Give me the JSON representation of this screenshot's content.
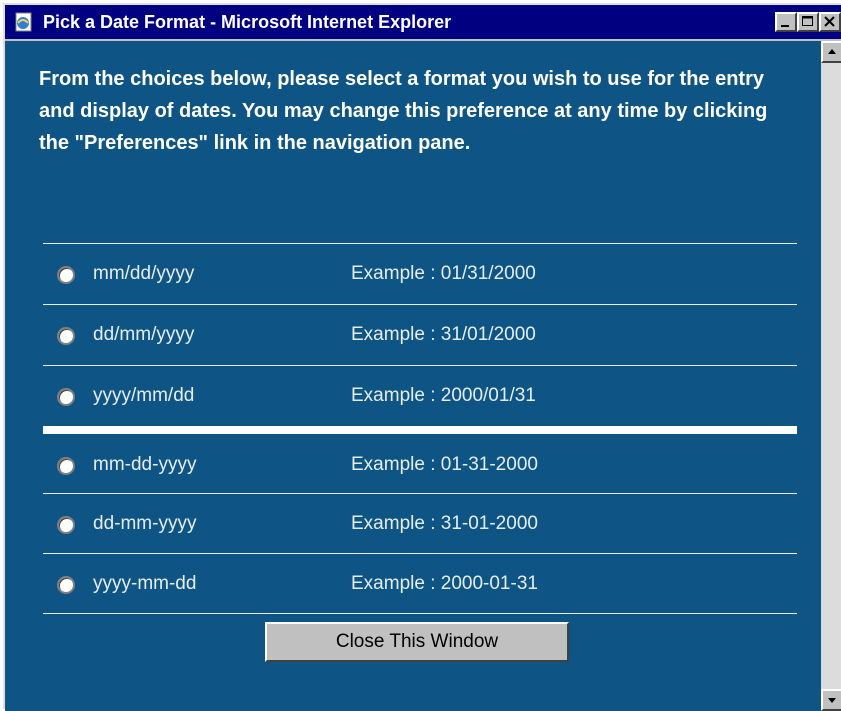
{
  "window": {
    "title": "Pick a Date Format - Microsoft Internet Explorer",
    "icon": "ie-page-icon"
  },
  "intro": "From the choices below, please select a format you wish to use for the entry and display of dates. You may change this preference at any time by clicking the \"Preferences\" link in the navigation pane.",
  "options": [
    {
      "label": "mm/dd/yyyy",
      "example": "Example : 01/31/2000"
    },
    {
      "label": "dd/mm/yyyy",
      "example": "Example : 31/01/2000"
    },
    {
      "label": "yyyy/mm/dd",
      "example": "Example : 2000/01/31"
    },
    {
      "label": "mm-dd-yyyy",
      "example": "Example : 01-31-2000"
    },
    {
      "label": "dd-mm-yyyy",
      "example": "Example : 31-01-2000"
    },
    {
      "label": "yyyy-mm-dd",
      "example": "Example : 2000-01-31"
    }
  ],
  "close_button": "Close This Window",
  "colors": {
    "titlebar": "#000080",
    "content_background": "#0e5585",
    "chrome": "#c0c0c0"
  }
}
